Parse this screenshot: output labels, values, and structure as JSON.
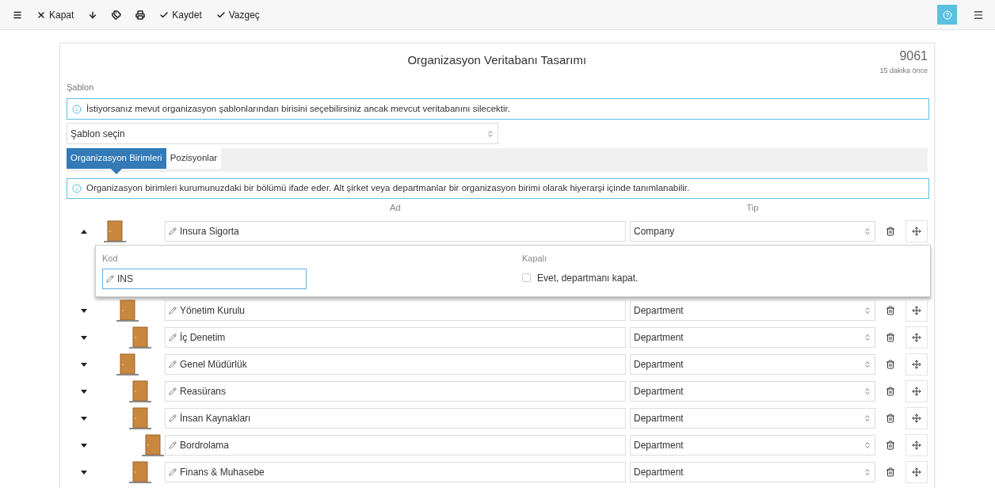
{
  "toolbar": {
    "buttons": [
      {
        "kind": "menu"
      },
      {
        "kind": "close",
        "label": "Kapat"
      },
      {
        "kind": "down"
      },
      {
        "kind": "tags"
      },
      {
        "kind": "print"
      },
      {
        "kind": "check",
        "label": "Kaydet"
      },
      {
        "kind": "check",
        "label": "Vazgeç"
      }
    ]
  },
  "form": {
    "title": "Organizasyon Veritabanı Tasarımı",
    "number": "9061",
    "time": "15 dakika önce",
    "template_label": "Şablon",
    "template_info": "İstiyorsanız mevut organizasyon şablonlarından birisini seçebilirsiniz ancak mevcut veritabanını silecektir.",
    "template_select": "Şablon seçin",
    "tabs": [
      {
        "label": "Organizasyon Birimleri",
        "selected": true
      },
      {
        "label": "Pozisyonlar",
        "selected": false
      }
    ],
    "units_info": "Organizasyon birimleri kurumunuzdaki bir bölümü ifade eder. Alt şirket veya departmanlar bir organizasyon birimi olarak hiyerarşi içinde tanımlanabilir.",
    "columns": [
      "Ad",
      "Tip"
    ],
    "units": [
      {
        "name": "Insura Sigorta",
        "type": "Company",
        "expanded": true,
        "details": {
          "code_label": "Kod",
          "code": "INS",
          "closed_label": "Kapalı",
          "closed_option": "Evet, departmanı kapat.",
          "closed": false
        },
        "children": [
          {
            "name": "Yönetim Kurulu",
            "type": "Department",
            "expanded": false,
            "children": [
              {
                "name": "İç Denetim",
                "type": "Department",
                "expanded": false
              }
            ]
          },
          {
            "name": "Genel Müdürlük",
            "type": "Department",
            "expanded": false,
            "children": [
              {
                "name": "Reasürans",
                "type": "Department",
                "expanded": false
              },
              {
                "name": "İnsan Kaynakları",
                "type": "Department",
                "expanded": false,
                "children": [
                  {
                    "name": "Bordrolama",
                    "type": "Department",
                    "expanded": false
                  }
                ]
              },
              {
                "name": "Finans & Muhasebe",
                "type": "Department",
                "expanded": false
              }
            ]
          }
        ]
      }
    ]
  }
}
